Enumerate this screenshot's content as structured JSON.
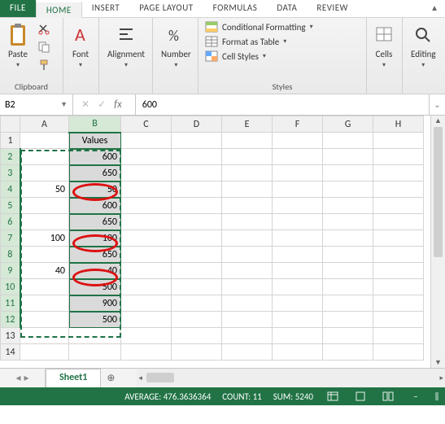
{
  "tabs": {
    "file": "FILE",
    "home": "HOME",
    "insert": "INSERT",
    "page_layout": "PAGE LAYOUT",
    "formulas": "FORMULAS",
    "data": "DATA",
    "review": "REVIEW"
  },
  "ribbon": {
    "clipboard": {
      "paste": "Paste",
      "label": "Clipboard"
    },
    "font": {
      "btn": "Font",
      "label": "Font"
    },
    "alignment": {
      "btn": "Alignment",
      "label": "Alignment"
    },
    "number": {
      "btn": "Number",
      "label": "Number"
    },
    "styles": {
      "cond": "Conditional Formatting",
      "table": "Format as Table",
      "cell": "Cell Styles",
      "label": "Styles"
    },
    "cells": {
      "btn": "Cells",
      "label": "Cells"
    },
    "editing": {
      "btn": "Editing",
      "label": "Editing"
    }
  },
  "namebox": "B2",
  "formula": "600",
  "columns": [
    "A",
    "B",
    "C",
    "D",
    "E",
    "F",
    "G",
    "H"
  ],
  "row_count": 14,
  "header_row": 1,
  "header_text": "Values",
  "col_a": {
    "4": "50",
    "7": "100",
    "9": "40"
  },
  "col_b": {
    "2": "600",
    "3": "650",
    "4": "50",
    "5": "600",
    "6": "650",
    "7": "100",
    "8": "650",
    "9": "40",
    "10": "500",
    "11": "900",
    "12": "500"
  },
  "circled_rows": [
    4,
    7,
    9
  ],
  "sheet": {
    "name": "Sheet1",
    "add": "+"
  },
  "status": {
    "average_label": "AVERAGE:",
    "average": "476.3636364",
    "count_label": "COUNT:",
    "count": "11",
    "sum_label": "SUM:",
    "sum": "5240"
  },
  "chart_data": {
    "type": "table",
    "title": "Values",
    "categories": [
      2,
      3,
      4,
      5,
      6,
      7,
      8,
      9,
      10,
      11,
      12
    ],
    "values": [
      600,
      650,
      50,
      600,
      650,
      100,
      650,
      40,
      500,
      900,
      500
    ]
  }
}
